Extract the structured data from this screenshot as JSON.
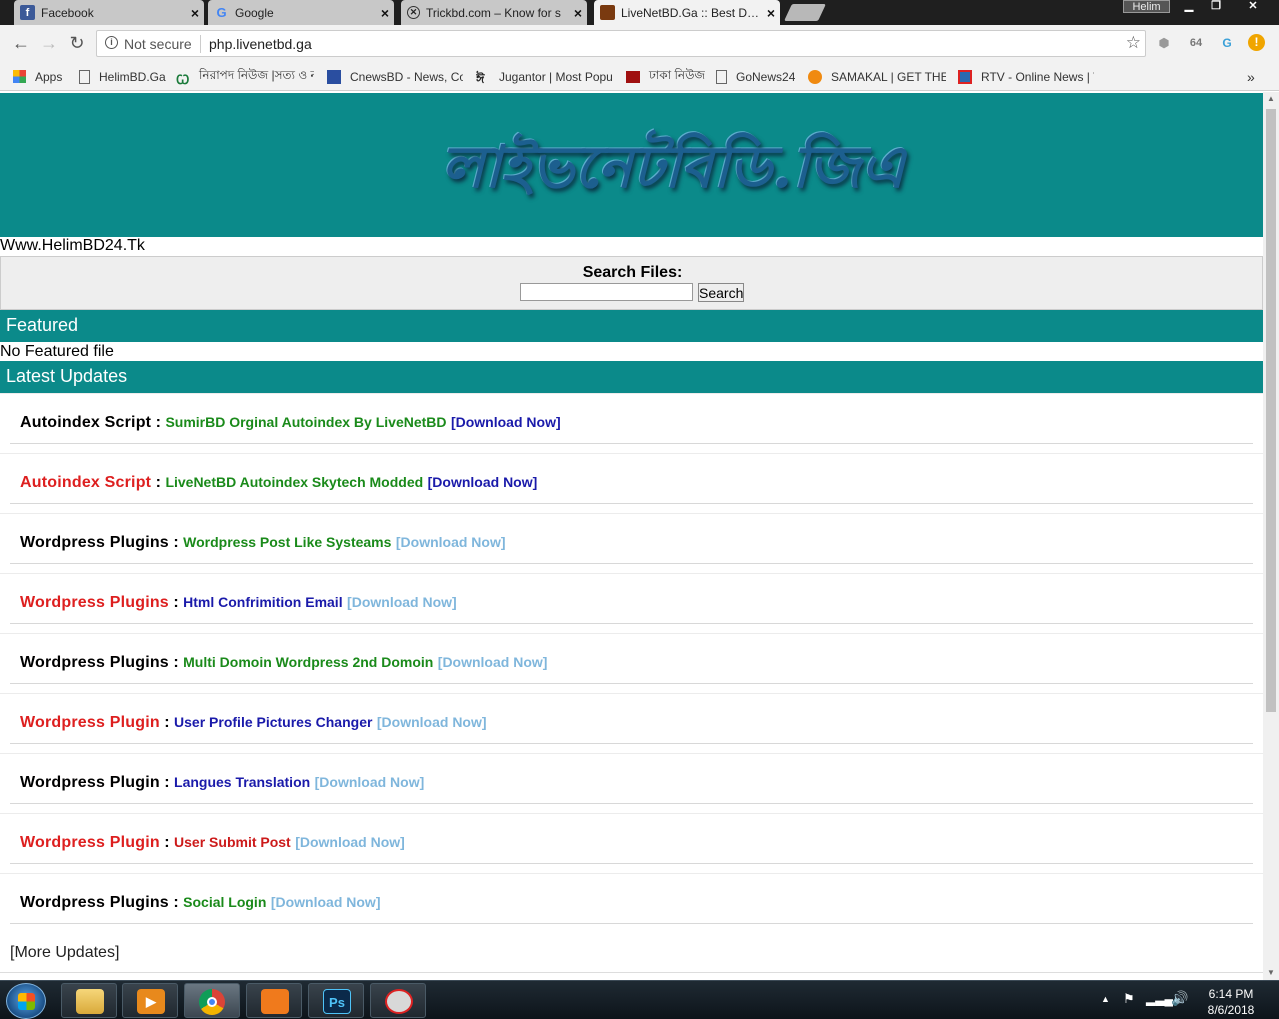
{
  "tabs": [
    {
      "title": "Facebook",
      "icon": "facebook-icon",
      "active": false
    },
    {
      "title": "Google",
      "icon": "google-icon",
      "active": false
    },
    {
      "title": "Trickbd.com – Know for s",
      "icon": "trickbd-icon",
      "active": false
    },
    {
      "title": "LiveNetBD.Ga :: Best Dow",
      "icon": "livenetbd-icon",
      "active": true
    }
  ],
  "window": {
    "user": "Helim",
    "minimize": "▁",
    "restore": "❐",
    "close": "✕"
  },
  "address": {
    "security": "Not secure",
    "url": "php.livenetbd.ga"
  },
  "extensions": {
    "ext2": "64"
  },
  "bookmarks": [
    {
      "label": "Apps",
      "icon": "apps-grid-icon"
    },
    {
      "label": "HelimBD.Ga",
      "icon": "page-icon"
    },
    {
      "label": "নিরাপদ নিউজ |সত্য ও ন",
      "icon": "niropod-icon"
    },
    {
      "label": "CnewsBD - News, Co",
      "icon": "cnews-icon"
    },
    {
      "label": "Jugantor | Most Popu",
      "icon": "jugantor-icon"
    },
    {
      "label": "ঢাকা নিউজ",
      "icon": "dhaka-news-icon"
    },
    {
      "label": "GoNews24",
      "icon": "page-icon"
    },
    {
      "label": "SAMAKAL | GET THE",
      "icon": "samakal-icon"
    },
    {
      "label": "RTV - Online News | V",
      "icon": "rtv-icon"
    }
  ],
  "bookmarks_overflow": "»",
  "page": {
    "logo_text": "লাইভনেটবিডি.জিএ",
    "site_url": "Www.HelimBD24.Tk",
    "search": {
      "label": "Search Files:",
      "value": "",
      "button": "Search"
    },
    "featured": {
      "title": "Featured",
      "empty_text": "No Featured file"
    },
    "latest": {
      "title": "Latest Updates"
    },
    "items": [
      {
        "category": "Autoindex Script",
        "name": "SumirBD Orginal Autoindex By LiveNetBD",
        "link": "[Download Now]"
      },
      {
        "category": "Autoindex Script",
        "name": "LiveNetBD Autoindex Skytech Modded",
        "link": "[Download Now]"
      },
      {
        "category": "Wordpress Plugins",
        "name": "Wordpress Post Like Systeams",
        "link": "[Download Now]"
      },
      {
        "category": "Wordpress Plugins",
        "name": "Html Confrimition Email",
        "link": "[Download Now]"
      },
      {
        "category": "Wordpress Plugins",
        "name": "Multi Domoin Wordpress 2nd Domoin",
        "link": "[Download Now]"
      },
      {
        "category": "Wordpress Plugin",
        "name": "User Profile Pictures Changer",
        "link": "[Download Now]"
      },
      {
        "category": "Wordpress Plugin",
        "name": "Langues Translation",
        "link": "[Download Now]"
      },
      {
        "category": "Wordpress Plugin",
        "name": "User Submit Post",
        "link": "[Download Now]"
      },
      {
        "category": "Wordpress Plugins",
        "name": "Social Login",
        "link": "[Download Now]"
      }
    ],
    "more": "[More Updates]"
  },
  "colors": {
    "teal": "#0b8a8a",
    "cat_black": "#000000",
    "cat_red": "#dd1f1f",
    "green": "#1a8a1a",
    "blue": "#1a1aaa",
    "red_text": "#cc1a1a",
    "light_blue": "#7fb6dc"
  },
  "item_styles": [
    {
      "cat": "cat_black",
      "name": "green",
      "link": "blue"
    },
    {
      "cat": "cat_red",
      "name": "green",
      "link": "blue"
    },
    {
      "cat": "cat_black",
      "name": "green",
      "link": "light_blue"
    },
    {
      "cat": "cat_red",
      "name": "blue",
      "link": "light_blue"
    },
    {
      "cat": "cat_black",
      "name": "green",
      "link": "light_blue"
    },
    {
      "cat": "cat_red",
      "name": "blue",
      "link": "light_blue"
    },
    {
      "cat": "cat_black",
      "name": "blue",
      "link": "light_blue"
    },
    {
      "cat": "cat_red",
      "name": "red_text",
      "link": "light_blue"
    },
    {
      "cat": "cat_black",
      "name": "green",
      "link": "light_blue"
    }
  ],
  "taskbar": {
    "apps": [
      {
        "name": "file-explorer",
        "icon": "folder-icon",
        "glyph": ""
      },
      {
        "name": "media-player",
        "icon": "media-player-icon",
        "glyph": "▶"
      },
      {
        "name": "chrome",
        "icon": "chrome-icon",
        "glyph": ""
      },
      {
        "name": "uc-browser",
        "icon": "uc-browser-icon",
        "glyph": ""
      },
      {
        "name": "photoshop",
        "icon": "photoshop-icon",
        "glyph": "Ps"
      },
      {
        "name": "snipping-tool",
        "icon": "snipping-tool-icon",
        "glyph": ""
      }
    ],
    "clock_time": "6:14 PM",
    "clock_date": "8/6/2018"
  }
}
